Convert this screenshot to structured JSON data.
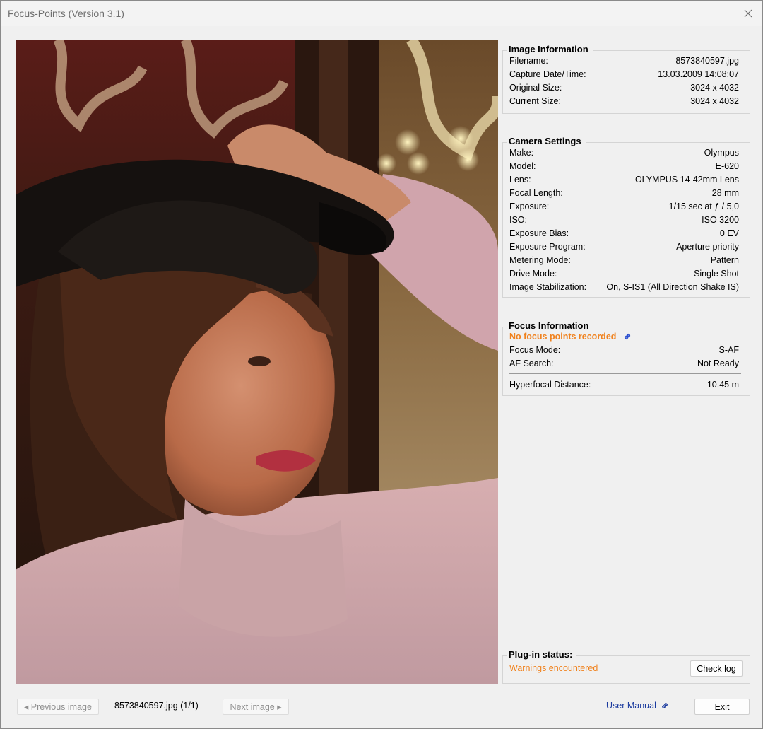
{
  "window": {
    "title": "Focus-Points (Version 3.1)"
  },
  "image_info": {
    "title": "Image Information",
    "rows": [
      {
        "label": "Filename:",
        "value": "8573840597.jpg"
      },
      {
        "label": "Capture Date/Time:",
        "value": "13.03.2009 14:08:07"
      },
      {
        "label": "Original Size:",
        "value": "3024 x 4032"
      },
      {
        "label": "Current Size:",
        "value": "3024 x 4032"
      }
    ]
  },
  "camera_settings": {
    "title": "Camera Settings",
    "rows": [
      {
        "label": "Make:",
        "value": "Olympus"
      },
      {
        "label": "Model:",
        "value": "E-620"
      },
      {
        "label": "Lens:",
        "value": "OLYMPUS 14-42mm Lens"
      },
      {
        "label": "Focal Length:",
        "value": "28 mm"
      },
      {
        "label": "Exposure:",
        "value": "1/15 sec at ƒ / 5,0"
      },
      {
        "label": "ISO:",
        "value": "ISO 3200"
      },
      {
        "label": "Exposure Bias:",
        "value": "0 EV"
      },
      {
        "label": "Exposure Program:",
        "value": "Aperture priority"
      },
      {
        "label": "Metering Mode:",
        "value": "Pattern"
      },
      {
        "label": "Drive Mode:",
        "value": "Single Shot"
      },
      {
        "label": "Image Stabilization:",
        "value": "On, S-IS1 (All Direction Shake IS)"
      }
    ]
  },
  "focus_info": {
    "title": "Focus Information",
    "warning": "No focus points recorded",
    "rows": [
      {
        "label": "Focus Mode:",
        "value": "S-AF"
      },
      {
        "label": "AF Search:",
        "value": "Not Ready"
      }
    ],
    "hyperfocal": {
      "label": "Hyperfocal Distance:",
      "value": "10.45 m"
    }
  },
  "plugin_status": {
    "title": "Plug-in status:",
    "text": "Warnings encountered",
    "check_log_label": "Check log"
  },
  "footer": {
    "prev_label": "◂ Previous image",
    "next_label": "Next image ▸",
    "file_position": "8573840597.jpg (1/1)",
    "manual_label": "User Manual",
    "exit_label": "Exit"
  },
  "colors": {
    "warning": "#f0821e",
    "link": "#1a3a9e"
  },
  "icons": {
    "close": "close-icon",
    "link": "chain-link-icon"
  }
}
